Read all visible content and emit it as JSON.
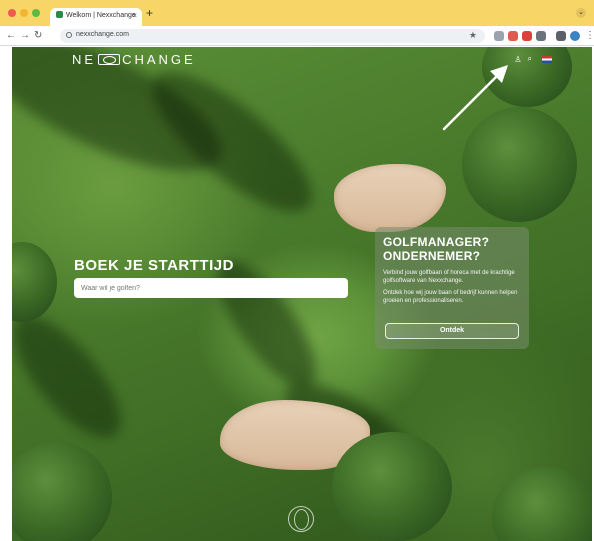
{
  "browser": {
    "tab_title": "Welkom | Nexxchange",
    "tab_close": "×",
    "new_tab": "+",
    "url": "nexxchange.com",
    "nav": {
      "back": "←",
      "forward": "→",
      "reload": "↻"
    },
    "bookmark_star": "★"
  },
  "header": {
    "brand_left": "NE",
    "brand_right": "CHANGE",
    "icons": [
      "user-icon",
      "search-icon",
      "language-flag-icon"
    ]
  },
  "hero": {
    "title": "BOEK JE STARTTIJD",
    "search_placeholder": "Waar wil je golfen?"
  },
  "promo": {
    "title_line1": "GOLFMANAGER?",
    "title_line2": "ONDERNEMER?",
    "text1": "Verbind jouw golfbaan of horeca met de krachtige golfsoftware van Nexxchange.",
    "text2": "Ontdek hoe wij jouw baan of bedrijf kunnen helpen groeien en professionaliseren.",
    "button": "Ontdek"
  },
  "colors": {
    "tabbar": "#f7d567",
    "grass": "#4a7c2c",
    "sand": "#e2c7a9",
    "card": "#7e8f70"
  }
}
